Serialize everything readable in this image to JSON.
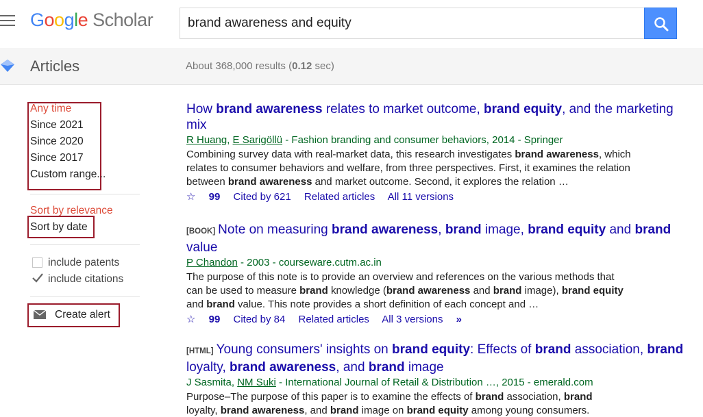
{
  "header": {
    "logo_letters": [
      "G",
      "o",
      "o",
      "g",
      "l",
      "e"
    ],
    "logo_suffix": "Scholar",
    "search_query": "brand awareness and equity"
  },
  "subheader": {
    "section_label": "Articles",
    "results_prefix": "About 368,000 results (",
    "results_time": "0.12",
    "results_suffix": " sec)"
  },
  "sidebar": {
    "time_filters": [
      "Any time",
      "Since 2021",
      "Since 2020",
      "Since 2017",
      "Custom range..."
    ],
    "sort_options": [
      "Sort by relevance",
      "Sort by date"
    ],
    "checkboxes": [
      {
        "label": "include patents",
        "checked": false
      },
      {
        "label": "include citations",
        "checked": true
      }
    ],
    "create_alert": "Create alert"
  },
  "results": [
    {
      "tag": "",
      "title_parts": [
        {
          "text": "How ",
          "bold": false
        },
        {
          "text": "brand awareness",
          "bold": true
        },
        {
          "text": " relates to market outcome, ",
          "bold": false
        },
        {
          "text": "brand equity",
          "bold": true
        },
        {
          "text": ", and the marketing mix",
          "bold": false
        }
      ],
      "authors": [
        {
          "text": "R Huang",
          "link": true
        },
        {
          "text": ", ",
          "link": false
        },
        {
          "text": "E Sarigöllü",
          "link": true
        },
        {
          "text": " - Fashion branding and consumer behaviors, 2014 - Springer",
          "link": false
        }
      ],
      "snippet_parts": [
        {
          "text": "Combining survey data with real-market data, this research investigates ",
          "bold": false
        },
        {
          "text": "brand awareness",
          "bold": true
        },
        {
          "text": ", which relates to consumer behaviors and welfare, from three perspectives. First, it examines the relation between ",
          "bold": false
        },
        {
          "text": "brand awareness",
          "bold": true
        },
        {
          "text": " and market outcome. Second, it explores the relation …",
          "bold": false
        }
      ],
      "cited_by": "Cited by 621",
      "related": "Related articles",
      "versions": "All 11 versions"
    },
    {
      "tag": "[BOOK]",
      "title_parts": [
        {
          "text": "Note on measuring ",
          "bold": false
        },
        {
          "text": "brand awareness",
          "bold": true
        },
        {
          "text": ", ",
          "bold": false
        },
        {
          "text": "brand",
          "bold": true
        },
        {
          "text": " image, ",
          "bold": false
        },
        {
          "text": "brand equity",
          "bold": true
        },
        {
          "text": " and ",
          "bold": false
        },
        {
          "text": "brand",
          "bold": true
        },
        {
          "text": " value",
          "bold": false
        }
      ],
      "authors": [
        {
          "text": "P Chandon",
          "link": true
        },
        {
          "text": " - 2003 - courseware.cutm.ac.in",
          "link": false
        }
      ],
      "snippet_parts": [
        {
          "text": "The purpose of this note is to provide an overview and references on the various methods that can be used to measure ",
          "bold": false
        },
        {
          "text": "brand",
          "bold": true
        },
        {
          "text": " knowledge (",
          "bold": false
        },
        {
          "text": "brand awareness",
          "bold": true
        },
        {
          "text": " and ",
          "bold": false
        },
        {
          "text": "brand",
          "bold": true
        },
        {
          "text": " image), ",
          "bold": false
        },
        {
          "text": "brand equity",
          "bold": true
        },
        {
          "text": " and ",
          "bold": false
        },
        {
          "text": "brand",
          "bold": true
        },
        {
          "text": " value. This note provides a short definition of each concept and …",
          "bold": false
        }
      ],
      "cited_by": "Cited by 84",
      "related": "Related articles",
      "versions": "All 3 versions"
    },
    {
      "tag": "[HTML]",
      "title_parts": [
        {
          "text": "Young consumers' insights on ",
          "bold": false
        },
        {
          "text": "brand equity",
          "bold": true
        },
        {
          "text": ": Effects of ",
          "bold": false
        },
        {
          "text": "brand",
          "bold": true
        },
        {
          "text": " association, ",
          "bold": false
        },
        {
          "text": "brand",
          "bold": true
        },
        {
          "text": " loyalty, ",
          "bold": false
        },
        {
          "text": "brand awareness",
          "bold": true
        },
        {
          "text": ", and ",
          "bold": false
        },
        {
          "text": "brand",
          "bold": true
        },
        {
          "text": " image",
          "bold": false
        }
      ],
      "authors": [
        {
          "text": "J Sasmita",
          "link": false
        },
        {
          "text": ", ",
          "link": false
        },
        {
          "text": "NM Suki",
          "link": true
        },
        {
          "text": " - International Journal of Retail & Distribution …, 2015 - emerald.com",
          "link": false
        }
      ],
      "snippet_parts": [
        {
          "text": "Purpose–The purpose of this paper is to examine the effects of ",
          "bold": false
        },
        {
          "text": "brand",
          "bold": true
        },
        {
          "text": " association, ",
          "bold": false
        },
        {
          "text": "brand",
          "bold": true
        },
        {
          "text": " loyalty, ",
          "bold": false
        },
        {
          "text": "brand awareness",
          "bold": true
        },
        {
          "text": ", and ",
          "bold": false
        },
        {
          "text": "brand",
          "bold": true
        },
        {
          "text": " image on ",
          "bold": false
        },
        {
          "text": "brand equity",
          "bold": true
        },
        {
          "text": " among young consumers.",
          "bold": false
        }
      ],
      "cited_by": "",
      "related": "",
      "versions": ""
    }
  ],
  "colors": {
    "link": "#1a0dab",
    "author_green": "#006621",
    "filter_red": "#dd4b39",
    "highlight_box": "#9b1c2c",
    "search_button": "#4d90fe"
  }
}
